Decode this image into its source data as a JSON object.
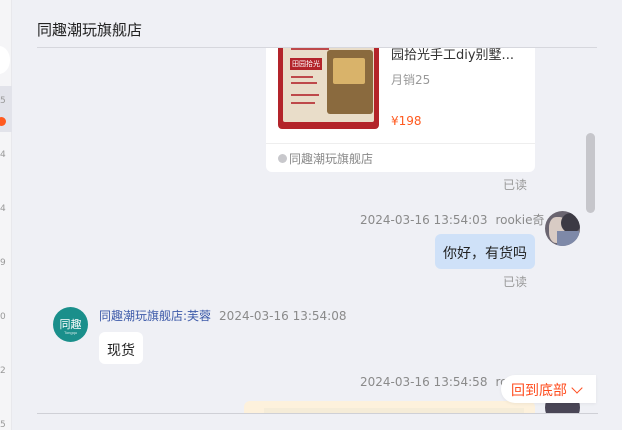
{
  "header": {
    "title": "同趣潮玩旗舰店"
  },
  "left_strip": {
    "numbers": [
      "5",
      "4",
      "4",
      "9",
      "0",
      "2",
      "5"
    ]
  },
  "product_card": {
    "name": "园拾光手工diy别墅...",
    "sales": "月销25",
    "price": "¥198",
    "shop": "同趣潮玩旗舰店",
    "thumb_title": "田园拾光"
  },
  "messages": [
    {
      "read_status": "已读"
    },
    {
      "timestamp": "2024-03-16 13:54:03",
      "sender": "rookie奇",
      "text": "你好，有货吗",
      "read_status": "已读"
    },
    {
      "sender": "同趣潮玩旗舰店:芙蓉",
      "timestamp": "2024-03-16 13:54:08",
      "text": "现货",
      "avatar_text": "同趣",
      "avatar_sub": "Tongqu"
    },
    {
      "timestamp": "2024-03-16 13:54:58",
      "sender": "ro"
    }
  ],
  "scroll_to_bottom": {
    "label": "回到底部"
  },
  "colors": {
    "accent": "#ff4d1f",
    "my_bubble": "#cfe1f8",
    "shop_name": "#3d5aa9",
    "brand_teal": "#1a8f8b",
    "background": "#eff0f5"
  }
}
